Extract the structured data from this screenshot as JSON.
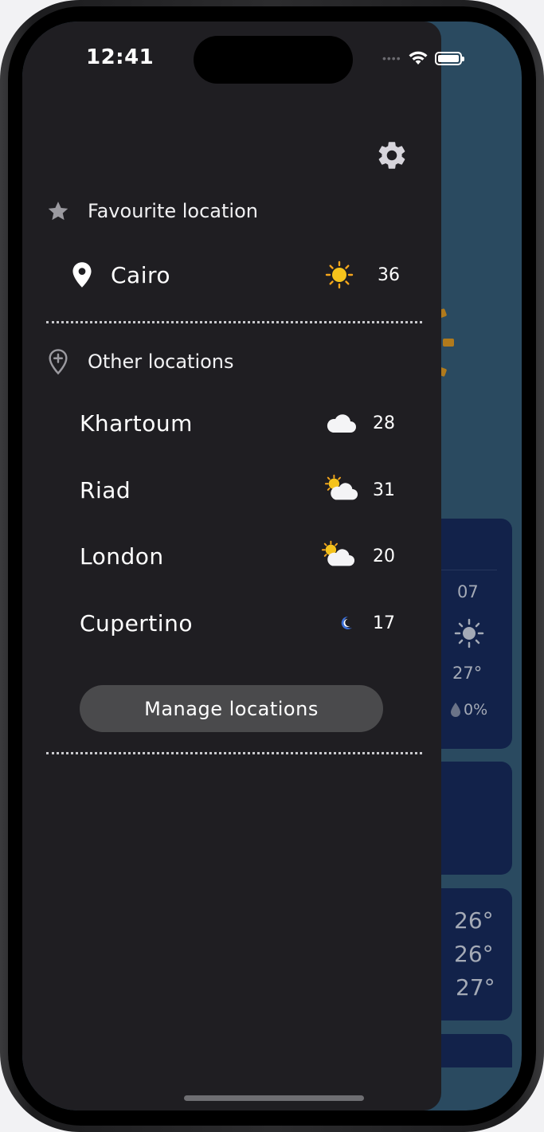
{
  "status_bar": {
    "time": "12:41",
    "signal_icon": "cellular-dots-icon",
    "wifi_icon": "wifi-icon",
    "battery_icon": "battery-icon"
  },
  "drawer": {
    "settings_icon": "gear-icon",
    "favourite": {
      "header_label": "Favourite location",
      "header_icon": "star-icon",
      "location": {
        "name": "Cairo",
        "location_icon": "map-pin-icon",
        "weather_icon": "sun-icon",
        "temp": "36"
      }
    },
    "other": {
      "header_label": "Other locations",
      "header_icon": "add-location-icon",
      "locations": [
        {
          "name": "Khartoum",
          "weather_icon": "cloud-icon",
          "temp": "28"
        },
        {
          "name": "Riad",
          "weather_icon": "partly-cloudy-icon",
          "temp": "31"
        },
        {
          "name": "London",
          "weather_icon": "partly-cloudy-icon",
          "temp": "20"
        },
        {
          "name": "Cupertino",
          "weather_icon": "moon-icon",
          "temp": "17"
        }
      ]
    },
    "manage_button_label": "Manage locations"
  },
  "background": {
    "hourly": {
      "hour": "07",
      "temp": "27°",
      "precip": "0%"
    },
    "daily_temps": [
      "26°",
      "26°",
      "27°"
    ]
  },
  "colors": {
    "drawer_bg": "#1f1e22",
    "screen_bg": "#2a4a60",
    "card_bg": "#12224a",
    "button_bg": "#4a4a4c",
    "sun": "#f5c31c"
  }
}
